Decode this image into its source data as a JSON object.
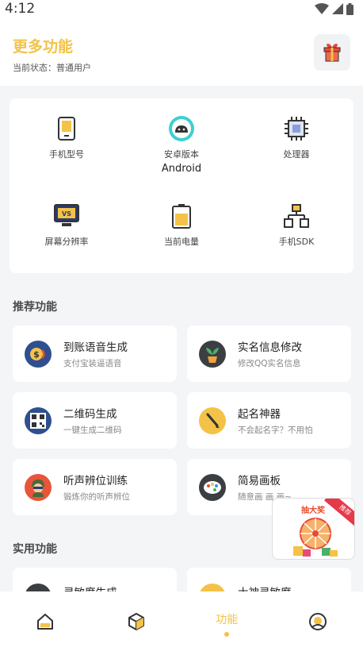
{
  "status_bar": {
    "time": "4:12"
  },
  "header": {
    "title": "更多功能",
    "status": "当前状态：普通用户"
  },
  "device_info": [
    {
      "label": "手机型号",
      "value": "",
      "icon": "phone-icon"
    },
    {
      "label": "安卓版本",
      "value": "Android",
      "icon": "android-icon"
    },
    {
      "label": "处理器",
      "value": "",
      "icon": "cpu-icon"
    },
    {
      "label": "屏幕分辨率",
      "value": "",
      "icon": "monitor-icon"
    },
    {
      "label": "当前电量",
      "value": "",
      "icon": "battery-icon"
    },
    {
      "label": "手机SDK",
      "value": "",
      "icon": "sdk-icon"
    }
  ],
  "sections": {
    "recommended": "推荐功能",
    "practical": "实用功能"
  },
  "features": [
    {
      "title": "到账语音生成",
      "desc": "支付宝装逼语音",
      "icon": "payment-voice-icon"
    },
    {
      "title": "实名信息修改",
      "desc": "修改QQ实名信息",
      "icon": "id-plant-icon"
    },
    {
      "title": "二维码生成",
      "desc": "一键生成二维码",
      "icon": "qrcode-icon"
    },
    {
      "title": "起名神器",
      "desc": "不会起名字？不用怕",
      "icon": "name-brush-icon"
    },
    {
      "title": "听声辨位训练",
      "desc": "锻炼你的听声辨位",
      "icon": "soldier-icon"
    },
    {
      "title": "简易画板",
      "desc": "随意画 画 画~",
      "icon": "palette-icon"
    },
    {
      "title": "灵敏度生成",
      "desc": "",
      "icon": "sensitivity-icon"
    },
    {
      "title": "大神灵敏度",
      "desc": "",
      "icon": "pro-sensitivity-icon"
    }
  ],
  "bottom_nav": [
    {
      "label": "",
      "icon": "home-icon"
    },
    {
      "label": "",
      "icon": "box-icon"
    },
    {
      "label": "功能",
      "icon": ""
    },
    {
      "label": "",
      "icon": "profile-icon"
    }
  ],
  "promo": {
    "title": "抽大奖",
    "badge": "推荐"
  },
  "colors": {
    "accent": "#f3c247",
    "page_bg": "#f4f5f7",
    "promo_red": "#e6394a"
  }
}
